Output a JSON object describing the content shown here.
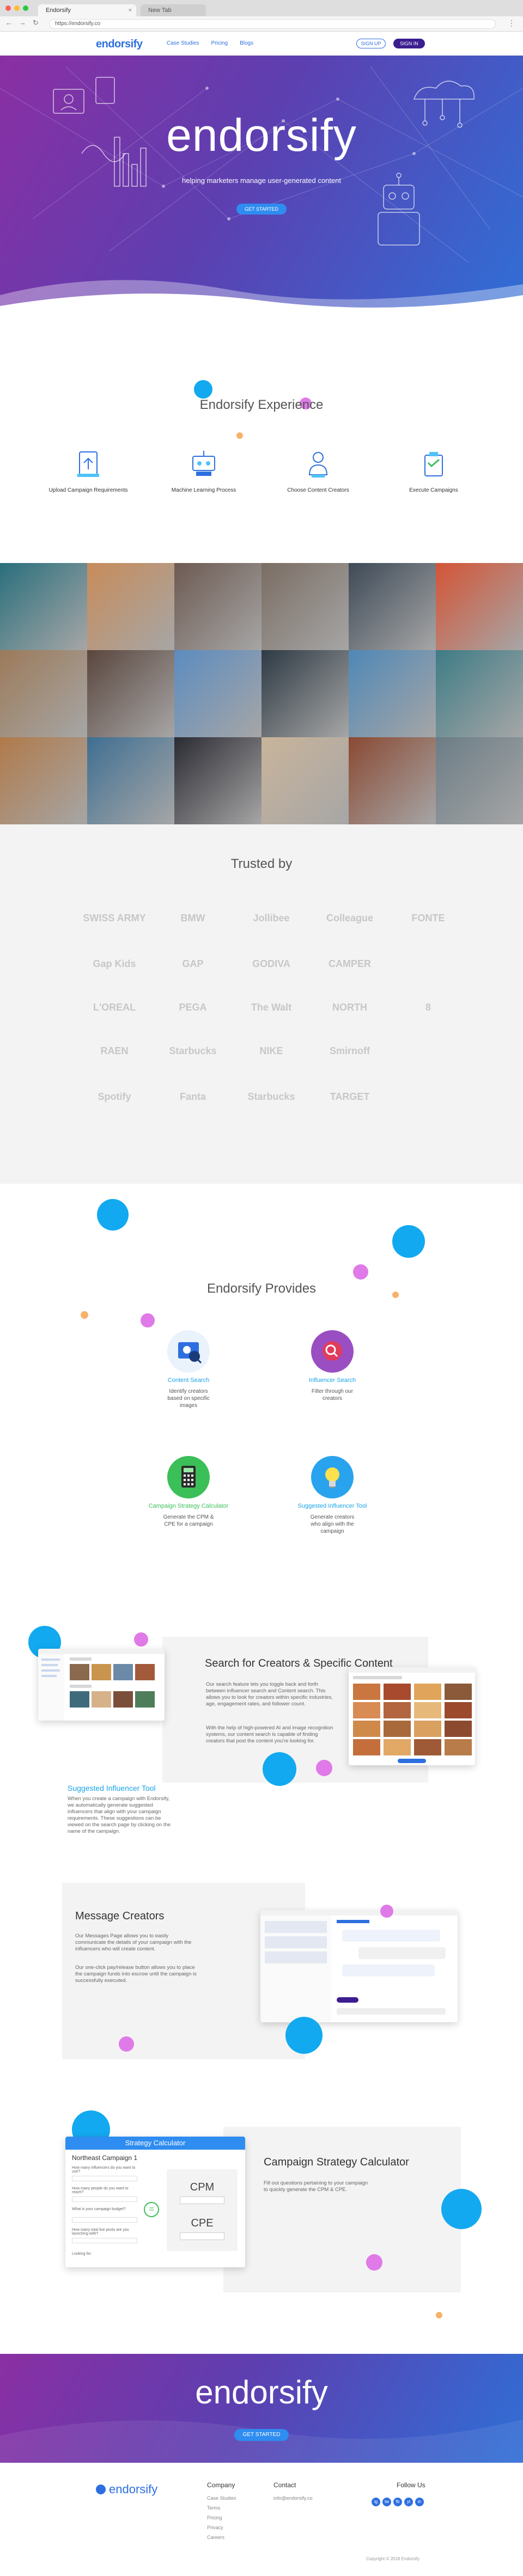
{
  "browser": {
    "tab1_title": "Endorsify",
    "tab2_title": "New Tab",
    "url": "https://endorsify.co"
  },
  "header": {
    "logo": "endorsify",
    "nav": [
      "Case Studies",
      "Pricing",
      "Blogs"
    ],
    "signup": "SIGN UP",
    "signin": "SIGN IN"
  },
  "hero": {
    "logo": "endorsify",
    "tagline": "helping marketers manage user-generated content",
    "cta": "GET STARTED"
  },
  "experience": {
    "title": "Endorsify Experience",
    "items": [
      {
        "label": "Upload Campaign Requirements",
        "icon": "upload-doc-icon"
      },
      {
        "label": "Machine Learning Process",
        "icon": "machine-learning-icon"
      },
      {
        "label": "Choose Content Creators",
        "icon": "creator-icon"
      },
      {
        "label": "Execute Campaigns",
        "icon": "execute-campaign-icon"
      }
    ]
  },
  "photos": {
    "colors": [
      "#2a6f7d",
      "#c88c5a",
      "#6d5a52",
      "#7a6d63",
      "#3e4a57",
      "#d45436",
      "#9c7a5a",
      "#5a463e",
      "#5c8cc0",
      "#2e3a44",
      "#4f88b6",
      "#3e7c86",
      "#b07a4a",
      "#3f6f92",
      "#2b2b33",
      "#c9b49a",
      "#8a4a33",
      "#6c7d86"
    ]
  },
  "trusted": {
    "title": "Trusted by",
    "brands": [
      "SWISS ARMY",
      "BMW",
      "Jollibee",
      "Colleague",
      "FONTE",
      "Gap Kids",
      "GAP",
      "GODIVA",
      "CAMPER",
      "",
      "L'OREAL",
      "PEGA",
      "The Walt",
      "NORTH",
      "8",
      "RAEN",
      "Starbucks",
      "NIKE",
      "Smirnoff",
      "",
      "Spotify",
      "Fanta",
      "Starbucks",
      "TARGET",
      ""
    ]
  },
  "provides": {
    "title": "Endorsify Provides",
    "items": [
      {
        "title": "Content Search",
        "desc": "Identify creators based on specific images",
        "color": "#1aa3e8"
      },
      {
        "title": "Influencer Search",
        "desc": "Filter through our creators",
        "color": "#1aa3e8"
      },
      {
        "title": "Campaign Strategy Calculator",
        "desc": "Generate the CPM & CPE for a campaign",
        "color": "#3bbf58"
      },
      {
        "title": "Suggested Influencer Tool",
        "desc": "Generate creators who align with the campaign",
        "color": "#1aa3e8"
      }
    ]
  },
  "search": {
    "title": "Search for Creators & Specific Content",
    "p1": "Our search feature lets you toggle back and forth between influencer search and Content search. This allows you to look for creators within specific industries, age, engagement rates, and follower count.",
    "p2": "With the help of high-powered AI and image recognition systems, our content search is capable of finding creators that post the content you're looking for."
  },
  "suggested": {
    "title": "Suggested Influencer Tool",
    "text": "When you create a campaign with Endorsify, we automatically generate suggested influencers that align with your campaign requirements. These suggestions can be viewed on the search page by clicking on the name of the campaign."
  },
  "message": {
    "title": "Message Creators",
    "p1": "Our Messages Page allows you to easily communicate the details of your campaign with the influencers who will create content.",
    "p2": "Our one-click pay/release button allows you to place the campaign funds into escrow until the campaign is successfully executed."
  },
  "calculator": {
    "title": "Campaign Strategy Calculator",
    "text": "Fill out questions pertaining to your campaign to quickly generate the CPM & CPE.",
    "card_title": "Strategy Calculator",
    "campaign": "Northeast Campaign 1",
    "cpm": "CPM",
    "cpe": "CPE",
    "q1": "How many influencers do you want to use?",
    "q2": "How many people do you want to reach?",
    "q3": "What is your campaign budget?",
    "q4": "How many total live posts are you launching with?",
    "looking": "Looking for:"
  },
  "cta": {
    "logo": "endorsify",
    "button": "GET STARTED"
  },
  "footer": {
    "logo": "endorsify",
    "company_h": "Company",
    "company_links": [
      "Case Studies",
      "Terms",
      "Pricing",
      "Privacy",
      "Careers"
    ],
    "contact_h": "Contact",
    "contact_email": "info@endorsify.co",
    "follow_h": "Follow Us",
    "social": [
      "ig",
      "tw",
      "fb",
      "yt",
      "in"
    ],
    "copyright": "Copyright © 2018 Endorsify"
  }
}
